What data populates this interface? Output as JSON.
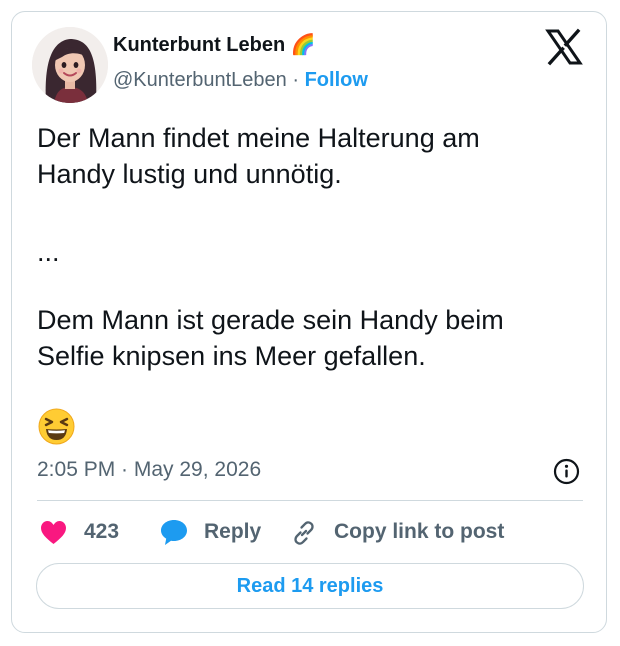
{
  "author": {
    "name": "Kunterbunt Leben 🌈",
    "handle": "@KunterbuntLeben",
    "separator": "·",
    "follow_label": "Follow"
  },
  "tweet": {
    "lines": [
      "Der Mann findet meine Halterung am",
      "Handy lustig und unnötig.",
      "...",
      "Dem Mann ist gerade sein Handy beim",
      "Selfie knipsen ins Meer gefallen."
    ],
    "emoji_icon": "grinning-squinting-face-icon",
    "timestamp": "2:05 PM · May 29, 2026"
  },
  "actions": {
    "like_count": "423",
    "reply_label": "Reply",
    "copy_link_label": "Copy link to post"
  },
  "footer": {
    "read_replies_label": "Read 14 replies"
  },
  "colors": {
    "accent": "#1d9bf0",
    "like": "#f91880",
    "text": "#0f1419",
    "muted": "#536471",
    "border": "#cfd9de"
  }
}
